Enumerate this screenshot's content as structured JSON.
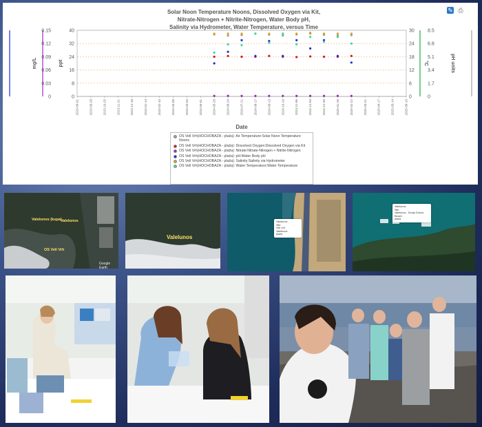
{
  "chart_data": {
    "type": "scatter",
    "title_lines": [
      "Solar Noon Temperature Noons, Dissolved Oxygen via Kit,",
      "Nitrate-Nitrogen + Nitrite-Nitrogen, Water Body pH,",
      "Salinity via Hydrometer, Water Temperature, versus Time"
    ],
    "xlabel": "Date",
    "x_ticks": [
      "2023-09-01",
      "2023-09-28",
      "2023-10-25",
      "2023-11-21",
      "2023-12-18",
      "2024-01-14",
      "2024-02-10",
      "2024-03-08",
      "2024-04-04",
      "2024-05-01",
      "2024-05-28",
      "2024-06-24",
      "2024-07-21",
      "2024-08-17",
      "2024-09-13",
      "2024-10-10",
      "2024-11-06",
      "2024-12-03",
      "2024-12-30",
      "2025-01-26",
      "2025-02-22",
      "2025-03-21",
      "2025-04-17",
      "2025-05-14",
      "2025-06-10"
    ],
    "axes_left": [
      {
        "label": "mg/L",
        "ticks": [
          "0",
          "0.03",
          "0.06",
          "0.09",
          "0.12",
          "0.15"
        ],
        "color": "#1f2fd0"
      },
      {
        "label": "ppt",
        "ticks": [
          "0",
          "8",
          "16",
          "24",
          "32",
          "40"
        ],
        "color": "#9b2bb8"
      }
    ],
    "axes_right": [
      {
        "label": "°C",
        "ticks": [
          "0",
          "6",
          "12",
          "18",
          "24",
          "30"
        ],
        "color": "#1fa84a"
      },
      {
        "label": "pH units",
        "ticks": [
          "0",
          "1.7",
          "3.4",
          "5.1",
          "6.8",
          "8.5"
        ],
        "color": "#a0a0a0"
      }
    ],
    "plot_ylim": [
      0,
      40
    ],
    "series": [
      {
        "name": "OS Vell Vrh(HOCHOBAZA - plaža): Air Temperature:Solar Noon Temperature Noons",
        "color": "#999999",
        "x_index": [
          10,
          11,
          12,
          13,
          14,
          15,
          16,
          17,
          18,
          19,
          20
        ],
        "values": [
          37.5,
          36.8,
          37.2,
          38,
          37.4,
          36.9,
          37.5,
          38,
          37.3,
          36.9,
          37.1
        ]
      },
      {
        "name": "OS Vell Vrh(HOCHOBAZA - plaža): Dissolved Oxygen:Dissolved Oxygen via Kit",
        "color": "#d7191c",
        "x_index": [
          10,
          11,
          12,
          13,
          14,
          15,
          16,
          17,
          18,
          19,
          20
        ],
        "values": [
          24,
          24.5,
          24,
          24,
          24.5,
          24,
          23.8,
          24.2,
          24,
          24,
          24.5
        ]
      },
      {
        "name": "OS Vell Vrh(HOCHOBAZA - plaža): Nitrate:Nitrate-Nitrogen + Nitrite-Nitrogen",
        "color": "#9b2bb8",
        "x_index": [
          10,
          11,
          12,
          13,
          14,
          15,
          16,
          17,
          18,
          19,
          20
        ],
        "values": [
          0.3,
          0.3,
          0.3,
          0.3,
          0.3,
          0.3,
          0.3,
          0.3,
          0.3,
          0.3,
          0.3
        ]
      },
      {
        "name": "OS Vell Vrh(HOCHOBAZA - plaža): pH:Water Body pH",
        "color": "#1f2fd0",
        "x_index": [
          10,
          11,
          12,
          13,
          14,
          15,
          16,
          17,
          18,
          19,
          20
        ],
        "values": [
          20,
          27,
          34,
          24.5,
          33.5,
          24.5,
          34,
          29,
          34,
          24.5,
          20.5
        ]
      },
      {
        "name": "OS Vell Vrh(HOCHOBAZA - plaža): Salinity:Salinity via Hydrometer",
        "color": "#e0a21a",
        "x_index": [
          10,
          11,
          12,
          13,
          14,
          15,
          16,
          17,
          18,
          19,
          20
        ],
        "values": [
          38,
          38,
          38,
          38,
          38,
          38,
          38,
          38.5,
          38,
          38,
          38
        ]
      },
      {
        "name": "OS Vell Vrh(HOCHOBAZA - plaža): Water Temperature:Water Temperature",
        "color": "#3cd9a6",
        "x_index": [
          10,
          11,
          12,
          13,
          14,
          15,
          16,
          17,
          18,
          19,
          20
        ],
        "values": [
          26.5,
          31.5,
          31,
          38,
          32.5,
          38,
          31.5,
          36,
          33,
          36,
          32
        ]
      }
    ],
    "grid": true,
    "legend_position": "bottom"
  },
  "legend_items": [
    {
      "label": "OS Vell Vrh(HOCHOBAZA - plaža): Air Temperature:Solar Noon Temperature Noons",
      "color": "#999999"
    },
    {
      "label": "OS Vell Vrh(HOCHOBAZA - plaža): Dissolved Oxygen:Dissolved Oxygen via Kit",
      "color": "#d7191c"
    },
    {
      "label": "OS Vell Vrh(HOCHOBAZA - plaža): Nitrate:Nitrate-Nitrogen + Nitrite-Nitrogen",
      "color": "#9b2bb8"
    },
    {
      "label": "OS Vell Vrh(HOCHOBAZA - plaža): pH:Water Body pH",
      "color": "#1f2fd0"
    },
    {
      "label": "OS Vell Vrh(HOCHOBAZA - plaža): Salinity:Salinity via Hydrometer",
      "color": "#e0a21a"
    },
    {
      "label": "OS Vell Vrh(HOCHOBAZA - plaža): Water Temperature:Water Temperature",
      "color": "#3cd9a6"
    }
  ],
  "icons": {
    "export": "export-icon",
    "print": "print-icon"
  },
  "maps": {
    "map1": {
      "label1": "Valelunos (kupa)",
      "label2": "Valelunos",
      "label3": "OS Vell Vrh",
      "credit": "Google Earth"
    },
    "map2": {
      "label": "Valelunos"
    },
    "map3": {
      "popup": [
        "Valelunos",
        "Site",
        "Vell Vrh",
        "Valelunos",
        "plaža"
      ]
    },
    "map4": {
      "popup": [
        "Valelunos",
        "Site",
        "Valelunos - Donja Gorica Beach",
        "plaža"
      ]
    }
  }
}
